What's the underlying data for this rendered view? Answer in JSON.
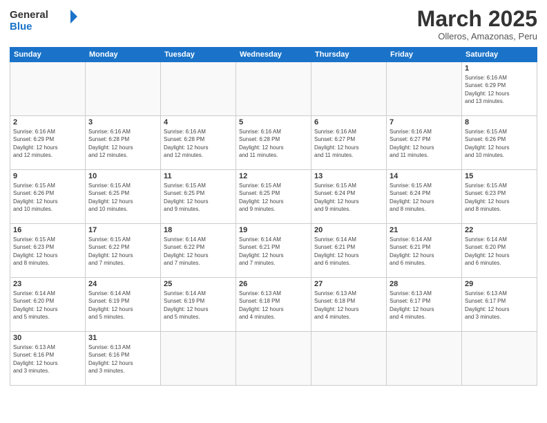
{
  "header": {
    "logo_general": "General",
    "logo_blue": "Blue",
    "month_year": "March 2025",
    "location": "Olleros, Amazonas, Peru"
  },
  "days_of_week": [
    "Sunday",
    "Monday",
    "Tuesday",
    "Wednesday",
    "Thursday",
    "Friday",
    "Saturday"
  ],
  "weeks": [
    [
      {
        "day": "",
        "info": ""
      },
      {
        "day": "",
        "info": ""
      },
      {
        "day": "",
        "info": ""
      },
      {
        "day": "",
        "info": ""
      },
      {
        "day": "",
        "info": ""
      },
      {
        "day": "",
        "info": ""
      },
      {
        "day": "1",
        "info": "Sunrise: 6:16 AM\nSunset: 6:29 PM\nDaylight: 12 hours\nand 13 minutes."
      }
    ],
    [
      {
        "day": "2",
        "info": "Sunrise: 6:16 AM\nSunset: 6:29 PM\nDaylight: 12 hours\nand 12 minutes."
      },
      {
        "day": "3",
        "info": "Sunrise: 6:16 AM\nSunset: 6:28 PM\nDaylight: 12 hours\nand 12 minutes."
      },
      {
        "day": "4",
        "info": "Sunrise: 6:16 AM\nSunset: 6:28 PM\nDaylight: 12 hours\nand 12 minutes."
      },
      {
        "day": "5",
        "info": "Sunrise: 6:16 AM\nSunset: 6:28 PM\nDaylight: 12 hours\nand 11 minutes."
      },
      {
        "day": "6",
        "info": "Sunrise: 6:16 AM\nSunset: 6:27 PM\nDaylight: 12 hours\nand 11 minutes."
      },
      {
        "day": "7",
        "info": "Sunrise: 6:16 AM\nSunset: 6:27 PM\nDaylight: 12 hours\nand 11 minutes."
      },
      {
        "day": "8",
        "info": "Sunrise: 6:15 AM\nSunset: 6:26 PM\nDaylight: 12 hours\nand 10 minutes."
      }
    ],
    [
      {
        "day": "9",
        "info": "Sunrise: 6:15 AM\nSunset: 6:26 PM\nDaylight: 12 hours\nand 10 minutes."
      },
      {
        "day": "10",
        "info": "Sunrise: 6:15 AM\nSunset: 6:25 PM\nDaylight: 12 hours\nand 10 minutes."
      },
      {
        "day": "11",
        "info": "Sunrise: 6:15 AM\nSunset: 6:25 PM\nDaylight: 12 hours\nand 9 minutes."
      },
      {
        "day": "12",
        "info": "Sunrise: 6:15 AM\nSunset: 6:25 PM\nDaylight: 12 hours\nand 9 minutes."
      },
      {
        "day": "13",
        "info": "Sunrise: 6:15 AM\nSunset: 6:24 PM\nDaylight: 12 hours\nand 9 minutes."
      },
      {
        "day": "14",
        "info": "Sunrise: 6:15 AM\nSunset: 6:24 PM\nDaylight: 12 hours\nand 8 minutes."
      },
      {
        "day": "15",
        "info": "Sunrise: 6:15 AM\nSunset: 6:23 PM\nDaylight: 12 hours\nand 8 minutes."
      }
    ],
    [
      {
        "day": "16",
        "info": "Sunrise: 6:15 AM\nSunset: 6:23 PM\nDaylight: 12 hours\nand 8 minutes."
      },
      {
        "day": "17",
        "info": "Sunrise: 6:15 AM\nSunset: 6:22 PM\nDaylight: 12 hours\nand 7 minutes."
      },
      {
        "day": "18",
        "info": "Sunrise: 6:14 AM\nSunset: 6:22 PM\nDaylight: 12 hours\nand 7 minutes."
      },
      {
        "day": "19",
        "info": "Sunrise: 6:14 AM\nSunset: 6:21 PM\nDaylight: 12 hours\nand 7 minutes."
      },
      {
        "day": "20",
        "info": "Sunrise: 6:14 AM\nSunset: 6:21 PM\nDaylight: 12 hours\nand 6 minutes."
      },
      {
        "day": "21",
        "info": "Sunrise: 6:14 AM\nSunset: 6:21 PM\nDaylight: 12 hours\nand 6 minutes."
      },
      {
        "day": "22",
        "info": "Sunrise: 6:14 AM\nSunset: 6:20 PM\nDaylight: 12 hours\nand 6 minutes."
      }
    ],
    [
      {
        "day": "23",
        "info": "Sunrise: 6:14 AM\nSunset: 6:20 PM\nDaylight: 12 hours\nand 5 minutes."
      },
      {
        "day": "24",
        "info": "Sunrise: 6:14 AM\nSunset: 6:19 PM\nDaylight: 12 hours\nand 5 minutes."
      },
      {
        "day": "25",
        "info": "Sunrise: 6:14 AM\nSunset: 6:19 PM\nDaylight: 12 hours\nand 5 minutes."
      },
      {
        "day": "26",
        "info": "Sunrise: 6:13 AM\nSunset: 6:18 PM\nDaylight: 12 hours\nand 4 minutes."
      },
      {
        "day": "27",
        "info": "Sunrise: 6:13 AM\nSunset: 6:18 PM\nDaylight: 12 hours\nand 4 minutes."
      },
      {
        "day": "28",
        "info": "Sunrise: 6:13 AM\nSunset: 6:17 PM\nDaylight: 12 hours\nand 4 minutes."
      },
      {
        "day": "29",
        "info": "Sunrise: 6:13 AM\nSunset: 6:17 PM\nDaylight: 12 hours\nand 3 minutes."
      }
    ],
    [
      {
        "day": "30",
        "info": "Sunrise: 6:13 AM\nSunset: 6:16 PM\nDaylight: 12 hours\nand 3 minutes."
      },
      {
        "day": "31",
        "info": "Sunrise: 6:13 AM\nSunset: 6:16 PM\nDaylight: 12 hours\nand 3 minutes."
      },
      {
        "day": "",
        "info": ""
      },
      {
        "day": "",
        "info": ""
      },
      {
        "day": "",
        "info": ""
      },
      {
        "day": "",
        "info": ""
      },
      {
        "day": "",
        "info": ""
      }
    ]
  ]
}
